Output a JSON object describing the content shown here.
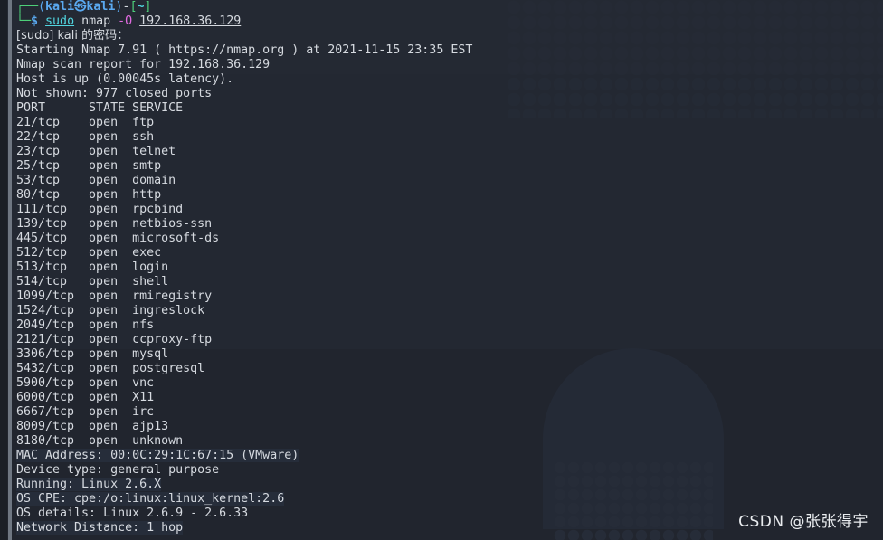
{
  "terminal": {
    "prompt": {
      "top_line_corner": "┌──",
      "paren_open": "(",
      "user": "kali",
      "at_symbol": "㉿",
      "host": "kali",
      "paren_close": ")",
      "dash": "-",
      "bracket_open": "[",
      "cwd": "~",
      "bracket_close": "]",
      "bottom_line_corner": "└─",
      "sigil": "$"
    },
    "command": {
      "sudo": "sudo",
      "program": "nmap",
      "flag": "-O",
      "target": "192.168.36.129"
    },
    "sudo_password_prompt": "[sudo] kali 的密码：",
    "output_header": [
      "Starting Nmap 7.91 ( https://nmap.org ) at 2021-11-15 23:35 EST",
      "Nmap scan report for 192.168.36.129",
      "Host is up (0.00045s latency).",
      "Not shown: 977 closed ports"
    ],
    "port_table": {
      "headers": [
        "PORT",
        "STATE",
        "SERVICE"
      ],
      "header_line": "PORT      STATE SERVICE",
      "rows": [
        {
          "line": "21/tcp    open  ftp",
          "port": "21/tcp",
          "state": "open",
          "service": "ftp"
        },
        {
          "line": "22/tcp    open  ssh",
          "port": "22/tcp",
          "state": "open",
          "service": "ssh"
        },
        {
          "line": "23/tcp    open  telnet",
          "port": "23/tcp",
          "state": "open",
          "service": "telnet"
        },
        {
          "line": "25/tcp    open  smtp",
          "port": "25/tcp",
          "state": "open",
          "service": "smtp"
        },
        {
          "line": "53/tcp    open  domain",
          "port": "53/tcp",
          "state": "open",
          "service": "domain"
        },
        {
          "line": "80/tcp    open  http",
          "port": "80/tcp",
          "state": "open",
          "service": "http"
        },
        {
          "line": "111/tcp   open  rpcbind",
          "port": "111/tcp",
          "state": "open",
          "service": "rpcbind"
        },
        {
          "line": "139/tcp   open  netbios-ssn",
          "port": "139/tcp",
          "state": "open",
          "service": "netbios-ssn"
        },
        {
          "line": "445/tcp   open  microsoft-ds",
          "port": "445/tcp",
          "state": "open",
          "service": "microsoft-ds"
        },
        {
          "line": "512/tcp   open  exec",
          "port": "512/tcp",
          "state": "open",
          "service": "exec"
        },
        {
          "line": "513/tcp   open  login",
          "port": "513/tcp",
          "state": "open",
          "service": "login"
        },
        {
          "line": "514/tcp   open  shell",
          "port": "514/tcp",
          "state": "open",
          "service": "shell"
        },
        {
          "line": "1099/tcp  open  rmiregistry",
          "port": "1099/tcp",
          "state": "open",
          "service": "rmiregistry"
        },
        {
          "line": "1524/tcp  open  ingreslock",
          "port": "1524/tcp",
          "state": "open",
          "service": "ingreslock"
        },
        {
          "line": "2049/tcp  open  nfs",
          "port": "2049/tcp",
          "state": "open",
          "service": "nfs"
        },
        {
          "line": "2121/tcp  open  ccproxy-ftp",
          "port": "2121/tcp",
          "state": "open",
          "service": "ccproxy-ftp"
        },
        {
          "line": "3306/tcp  open  mysql",
          "port": "3306/tcp",
          "state": "open",
          "service": "mysql"
        },
        {
          "line": "5432/tcp  open  postgresql",
          "port": "5432/tcp",
          "state": "open",
          "service": "postgresql"
        },
        {
          "line": "5900/tcp  open  vnc",
          "port": "5900/tcp",
          "state": "open",
          "service": "vnc"
        },
        {
          "line": "6000/tcp  open  X11",
          "port": "6000/tcp",
          "state": "open",
          "service": "X11"
        },
        {
          "line": "6667/tcp  open  irc",
          "port": "6667/tcp",
          "state": "open",
          "service": "irc"
        },
        {
          "line": "8009/tcp  open  ajp13",
          "port": "8009/tcp",
          "state": "open",
          "service": "ajp13"
        },
        {
          "line": "8180/tcp  open  unknown",
          "port": "8180/tcp",
          "state": "open",
          "service": "unknown"
        }
      ]
    },
    "os_detection": [
      {
        "line": "MAC Address: 00:0C:29:1C:67:15 (VMware)",
        "selected": true
      },
      {
        "line": "Device type: general purpose",
        "selected": false
      },
      {
        "line": "Running: Linux 2.6.X",
        "selected": true
      },
      {
        "line": "OS CPE: cpe:/o:linux:linux_kernel:2.6",
        "selected": true
      },
      {
        "line": "OS details: Linux 2.6.9 - 2.6.33",
        "selected": false
      },
      {
        "line": "Network Distance: 1 hop",
        "selected": true
      }
    ]
  },
  "watermark": {
    "text": "CSDN @张张得宇"
  },
  "colors": {
    "background": "#21252e",
    "foreground": "#d6dae0",
    "prompt_green": "#4ed07a",
    "prompt_blue": "#5aa9f0",
    "prompt_cyan": "#51d6e0",
    "flag_magenta": "#e06be0",
    "selection": "#262d3a"
  }
}
